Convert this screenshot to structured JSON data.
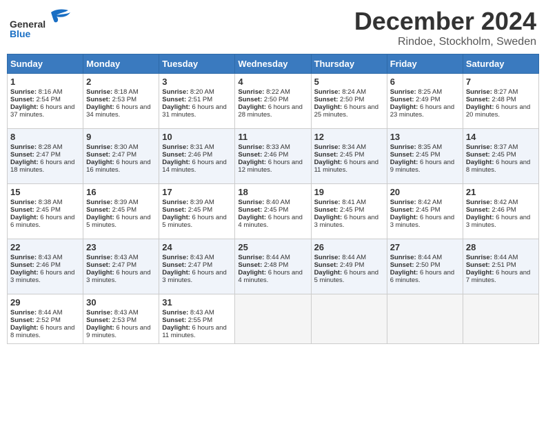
{
  "header": {
    "logo_line1": "General",
    "logo_line2": "Blue",
    "month": "December 2024",
    "location": "Rindoe, Stockholm, Sweden"
  },
  "days_of_week": [
    "Sunday",
    "Monday",
    "Tuesday",
    "Wednesday",
    "Thursday",
    "Friday",
    "Saturday"
  ],
  "weeks": [
    [
      {
        "day": "1",
        "info": "Sunrise: 8:16 AM\nSunset: 2:54 PM\nDaylight: 6 hours and 37 minutes."
      },
      {
        "day": "2",
        "info": "Sunrise: 8:18 AM\nSunset: 2:53 PM\nDaylight: 6 hours and 34 minutes."
      },
      {
        "day": "3",
        "info": "Sunrise: 8:20 AM\nSunset: 2:51 PM\nDaylight: 6 hours and 31 minutes."
      },
      {
        "day": "4",
        "info": "Sunrise: 8:22 AM\nSunset: 2:50 PM\nDaylight: 6 hours and 28 minutes."
      },
      {
        "day": "5",
        "info": "Sunrise: 8:24 AM\nSunset: 2:50 PM\nDaylight: 6 hours and 25 minutes."
      },
      {
        "day": "6",
        "info": "Sunrise: 8:25 AM\nSunset: 2:49 PM\nDaylight: 6 hours and 23 minutes."
      },
      {
        "day": "7",
        "info": "Sunrise: 8:27 AM\nSunset: 2:48 PM\nDaylight: 6 hours and 20 minutes."
      }
    ],
    [
      {
        "day": "8",
        "info": "Sunrise: 8:28 AM\nSunset: 2:47 PM\nDaylight: 6 hours and 18 minutes."
      },
      {
        "day": "9",
        "info": "Sunrise: 8:30 AM\nSunset: 2:47 PM\nDaylight: 6 hours and 16 minutes."
      },
      {
        "day": "10",
        "info": "Sunrise: 8:31 AM\nSunset: 2:46 PM\nDaylight: 6 hours and 14 minutes."
      },
      {
        "day": "11",
        "info": "Sunrise: 8:33 AM\nSunset: 2:46 PM\nDaylight: 6 hours and 12 minutes."
      },
      {
        "day": "12",
        "info": "Sunrise: 8:34 AM\nSunset: 2:45 PM\nDaylight: 6 hours and 11 minutes."
      },
      {
        "day": "13",
        "info": "Sunrise: 8:35 AM\nSunset: 2:45 PM\nDaylight: 6 hours and 9 minutes."
      },
      {
        "day": "14",
        "info": "Sunrise: 8:37 AM\nSunset: 2:45 PM\nDaylight: 6 hours and 8 minutes."
      }
    ],
    [
      {
        "day": "15",
        "info": "Sunrise: 8:38 AM\nSunset: 2:45 PM\nDaylight: 6 hours and 6 minutes."
      },
      {
        "day": "16",
        "info": "Sunrise: 8:39 AM\nSunset: 2:45 PM\nDaylight: 6 hours and 5 minutes."
      },
      {
        "day": "17",
        "info": "Sunrise: 8:39 AM\nSunset: 2:45 PM\nDaylight: 6 hours and 5 minutes."
      },
      {
        "day": "18",
        "info": "Sunrise: 8:40 AM\nSunset: 2:45 PM\nDaylight: 6 hours and 4 minutes."
      },
      {
        "day": "19",
        "info": "Sunrise: 8:41 AM\nSunset: 2:45 PM\nDaylight: 6 hours and 3 minutes."
      },
      {
        "day": "20",
        "info": "Sunrise: 8:42 AM\nSunset: 2:45 PM\nDaylight: 6 hours and 3 minutes."
      },
      {
        "day": "21",
        "info": "Sunrise: 8:42 AM\nSunset: 2:46 PM\nDaylight: 6 hours and 3 minutes."
      }
    ],
    [
      {
        "day": "22",
        "info": "Sunrise: 8:43 AM\nSunset: 2:46 PM\nDaylight: 6 hours and 3 minutes."
      },
      {
        "day": "23",
        "info": "Sunrise: 8:43 AM\nSunset: 2:47 PM\nDaylight: 6 hours and 3 minutes."
      },
      {
        "day": "24",
        "info": "Sunrise: 8:43 AM\nSunset: 2:47 PM\nDaylight: 6 hours and 3 minutes."
      },
      {
        "day": "25",
        "info": "Sunrise: 8:44 AM\nSunset: 2:48 PM\nDaylight: 6 hours and 4 minutes."
      },
      {
        "day": "26",
        "info": "Sunrise: 8:44 AM\nSunset: 2:49 PM\nDaylight: 6 hours and 5 minutes."
      },
      {
        "day": "27",
        "info": "Sunrise: 8:44 AM\nSunset: 2:50 PM\nDaylight: 6 hours and 6 minutes."
      },
      {
        "day": "28",
        "info": "Sunrise: 8:44 AM\nSunset: 2:51 PM\nDaylight: 6 hours and 7 minutes."
      }
    ],
    [
      {
        "day": "29",
        "info": "Sunrise: 8:44 AM\nSunset: 2:52 PM\nDaylight: 6 hours and 8 minutes."
      },
      {
        "day": "30",
        "info": "Sunrise: 8:43 AM\nSunset: 2:53 PM\nDaylight: 6 hours and 9 minutes."
      },
      {
        "day": "31",
        "info": "Sunrise: 8:43 AM\nSunset: 2:55 PM\nDaylight: 6 hours and 11 minutes."
      },
      {
        "day": "",
        "info": ""
      },
      {
        "day": "",
        "info": ""
      },
      {
        "day": "",
        "info": ""
      },
      {
        "day": "",
        "info": ""
      }
    ]
  ]
}
